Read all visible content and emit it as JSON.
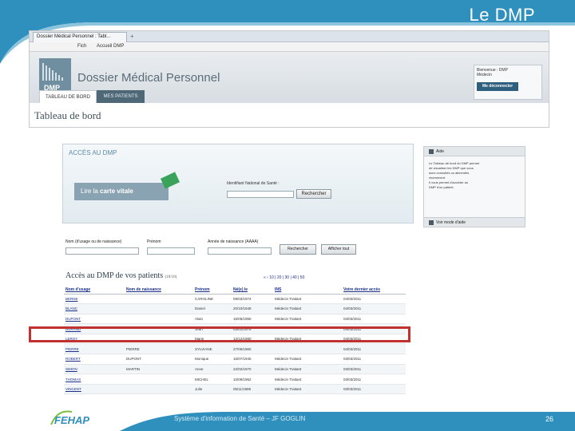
{
  "slide": {
    "title": "Le DMP",
    "footer_text": "Système d'information de Santé – JF GOGLIN",
    "page_number": "26",
    "footer_logo": "FEHAP",
    "colors": {
      "accent": "#2f8fbd",
      "highlight": "#c0312f",
      "dmp_dark": "#4e6878"
    }
  },
  "browser": {
    "tab_title": "Dossier Médical Personnel : Tabl...",
    "tab_plus": "+",
    "nav": {
      "fichier": "Fich",
      "accueil": "Accueil DMP"
    },
    "logo_text": "DMP",
    "app_title": "Dossier Médical Personnel",
    "user_lines": [
      "Bienvenue : DMP",
      "Médecin"
    ],
    "disconnect_label": "Me déconnecter",
    "menu": {
      "active": "TABLEAU DE BORD",
      "inactive": "MES PATIENTS"
    },
    "page_title": "Tableau de bord"
  },
  "access": {
    "title": "ACCÈS AU DMP",
    "card_prefix": "Lire la",
    "card_label": "carte vitale",
    "nir_label": "Identifiant National de Santé :",
    "nir_button": "Rechercher"
  },
  "aide": {
    "title": "Aide",
    "lines": [
      "Le Tableau de bord du DMP permet",
      "de visualiser les DMP que vous",
      "avez consultés ou alimentés",
      "récemment.",
      "Il vous permet d'accéder au",
      "DMP d'un patient."
    ],
    "footer": "Voir mode d'aide"
  },
  "search": {
    "nom_label": "Nom (d'usage ou de naissance)",
    "prenom_label": "Prénom",
    "annee_label": "Année de naissance (AAAA)",
    "search_button": "Rechercher",
    "show_all_button": "Afficher tout"
  },
  "patients": {
    "title": "Accès au DMP de vos patients",
    "count": "(10/10)",
    "pager_prev": "« ‹",
    "pages": "10 | 20 | 30 | 40 | 50",
    "columns": [
      "Nom d'usage",
      "Nom de naissance",
      "Prénom",
      "Né(e) le",
      "INS",
      "",
      "Votre dernier accès"
    ],
    "rows": [
      [
        "BERNE",
        "",
        "CAROLINE",
        "09/03/1974",
        "Médecin Traitant",
        "",
        "04/03/2011"
      ],
      [
        "BLANC",
        "",
        "Daniel",
        "20/10/1948",
        "Médecin Traitant",
        "",
        "04/03/2011"
      ],
      [
        "DUPONT",
        "",
        "Alain",
        "15/05/1955",
        "Médecin Traitant",
        "",
        "04/03/2011"
      ],
      [
        "DURAND",
        "",
        "Jean",
        "03/01/1976",
        "",
        "",
        "04/03/2011"
      ],
      [
        "LEROY",
        "",
        "Marie",
        "12/12/1980",
        "Médecin Traitant",
        "",
        "04/03/2011"
      ],
      [
        "PIERRE",
        "PIERRE",
        "SYLVIANE",
        "27/06/1960",
        "",
        "",
        "04/03/2011"
      ],
      [
        "ROBERT",
        "DUPONT",
        "Monique",
        "15/07/1945",
        "Médecin Traitant",
        "",
        "03/03/2011"
      ],
      [
        "SIMON",
        "MARTIN",
        "Anne",
        "22/02/1970",
        "Médecin Traitant",
        "",
        "03/03/2011"
      ],
      [
        "THOMAS",
        "",
        "MICHEL",
        "10/09/1952",
        "Médecin Traitant",
        "",
        "03/03/2011"
      ],
      [
        "VINCENT",
        "",
        "Julie",
        "05/11/1985",
        "Médecin Traitant",
        "",
        "03/03/2011"
      ]
    ]
  }
}
